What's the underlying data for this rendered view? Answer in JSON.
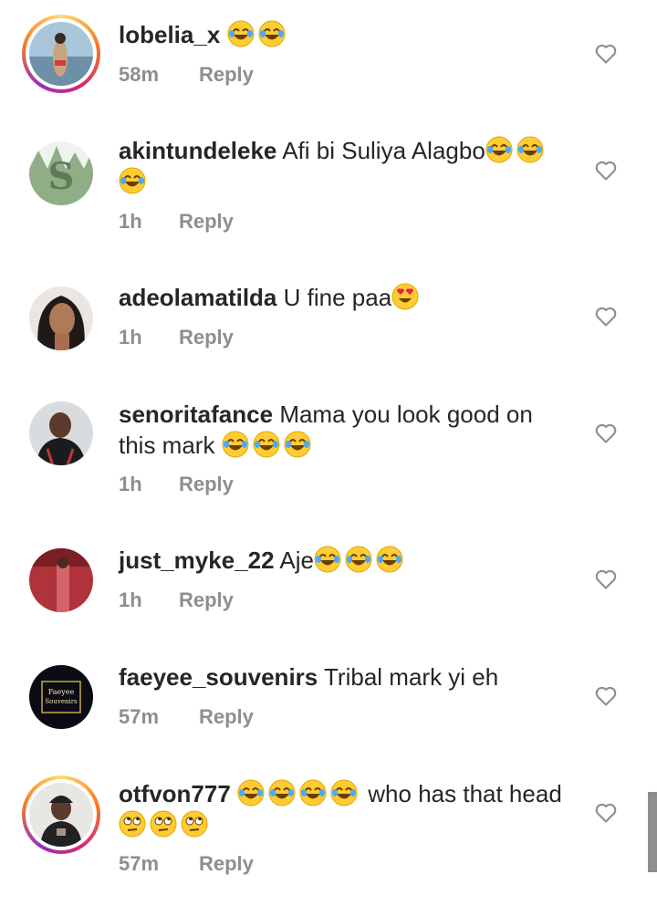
{
  "comments": [
    {
      "username": "lobelia_x",
      "text": "",
      "emojis_after": [
        "laugh",
        "laugh"
      ],
      "time": "58m",
      "reply": "Reply",
      "story_ring": true,
      "avatar_colors": [
        "#6d8fa7",
        "#d9e4ea",
        "#c7a37f"
      ]
    },
    {
      "username": "akintundeleke",
      "text": "Afi bi Suliya Alagbo",
      "emojis_after": [
        "laugh",
        "laugh",
        "laugh"
      ],
      "time": "1h",
      "reply": "Reply",
      "story_ring": false,
      "avatar_colors": [
        "#b8c9b1",
        "#5d7b57",
        "#f0f2ee"
      ]
    },
    {
      "username": "adeolamatilda",
      "text": "U fine paa",
      "emojis_after": [
        "heart-eyes"
      ],
      "time": "1h",
      "reply": "Reply",
      "story_ring": false,
      "avatar_colors": [
        "#e8dcd3",
        "#7b4f3a",
        "#1f1a18"
      ]
    },
    {
      "username": "senoritafance",
      "text": "Mama you look good on this mark",
      "emojis_after": [
        "laugh",
        "laugh",
        "laugh"
      ],
      "time": "1h",
      "reply": "Reply",
      "story_ring": false,
      "avatar_colors": [
        "#d9dcdf",
        "#1b1b1f",
        "#c0392b"
      ]
    },
    {
      "username": "just_myke_22",
      "text": "Aje",
      "emojis_after": [
        "laugh",
        "laugh",
        "laugh"
      ],
      "time": "1h",
      "reply": "Reply",
      "story_ring": false,
      "avatar_colors": [
        "#b0323a",
        "#d2646c",
        "#7a1f24"
      ]
    },
    {
      "username": "faeyee_souvenirs",
      "text": "Tribal mark yi eh",
      "emojis_after": [],
      "time": "57m",
      "reply": "Reply",
      "story_ring": false,
      "avatar_colors": [
        "#0b0b14",
        "#c9a648",
        "#f1e3b5"
      ],
      "avatar_text": [
        "Faeyee",
        "Souvenirs"
      ]
    },
    {
      "username": "otfvon777",
      "text_before_emojis": [
        "laugh",
        "laugh",
        "laugh",
        "laugh"
      ],
      "text": "who has that head",
      "emojis_after": [
        "eye-roll",
        "eye-roll",
        "eye-roll"
      ],
      "time": "57m",
      "reply": "Reply",
      "story_ring": true,
      "avatar_colors": [
        "#e9e7e4",
        "#222222",
        "#a89484"
      ]
    }
  ],
  "colors": {
    "text": "#262626",
    "meta": "#8e8e8e",
    "heart": "#8e8e8e",
    "ring": [
      "#feda75",
      "#fa7e1e",
      "#d62976",
      "#962fbf"
    ]
  },
  "icons": {
    "like": "heart-outline-icon"
  }
}
